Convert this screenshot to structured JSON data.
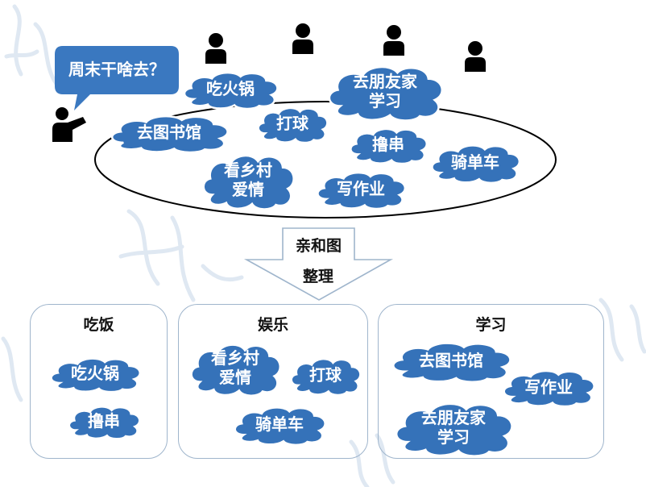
{
  "question": {
    "text": "周末干啥去？"
  },
  "brainstorm": {
    "ideas": [
      "吃火锅",
      "去朋友家\n学习",
      "去图书馆",
      "打球",
      "撸串",
      "骑单车",
      "看乡村\n爱情",
      "写作业"
    ]
  },
  "arrow": {
    "line1": "亲和图",
    "line2": "整理"
  },
  "groups": [
    {
      "title": "吃饭",
      "items": [
        "吃火锅",
        "撸串"
      ]
    },
    {
      "title": "娱乐",
      "items": [
        "看乡村\n爱情",
        "打球",
        "骑单车"
      ]
    },
    {
      "title": "学习",
      "items": [
        "去图书馆",
        "写作业",
        "去朋友家\n学习"
      ]
    }
  ],
  "colors": {
    "cloud": "#3572b9",
    "bubble": "#3a78c0",
    "outline": "#9fb5cc",
    "ellipse": "#000000"
  }
}
